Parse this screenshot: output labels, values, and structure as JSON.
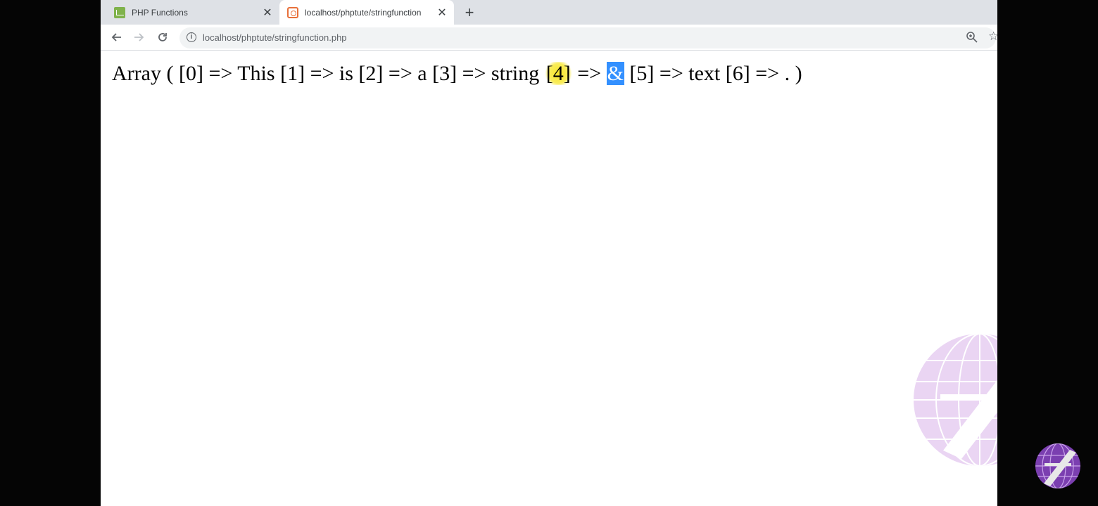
{
  "browser": {
    "tabs": [
      {
        "title": "PHP Functions",
        "favicon": "w3-favicon"
      },
      {
        "title": "localhost/phptute/stringfunction",
        "favicon": "xampp-favicon",
        "active": true
      }
    ],
    "new_tab": "+",
    "url": "localhost/phptute/stringfunction.php"
  },
  "output": {
    "prefix": "Array ( ",
    "items": [
      {
        "index": "[0]",
        "arrow": " => ",
        "value": "This "
      },
      {
        "index": "[1]",
        "arrow": " => ",
        "value": "is "
      },
      {
        "index": "[2]",
        "arrow": " => ",
        "value": "a "
      },
      {
        "index": "[3]",
        "arrow": " => ",
        "value": "string "
      },
      {
        "index": "[4]",
        "arrow": " => ",
        "value": "&"
      },
      {
        "index": "[5]",
        "arrow": " => ",
        "value": "text "
      },
      {
        "index": "[6]",
        "arrow": " => ",
        "value": ". "
      }
    ],
    "suffix": ")"
  },
  "colors": {
    "highlight_yellow": "#f7e62a",
    "selection_blue": "#3390ff",
    "watermark_purple": "#c89be0"
  }
}
